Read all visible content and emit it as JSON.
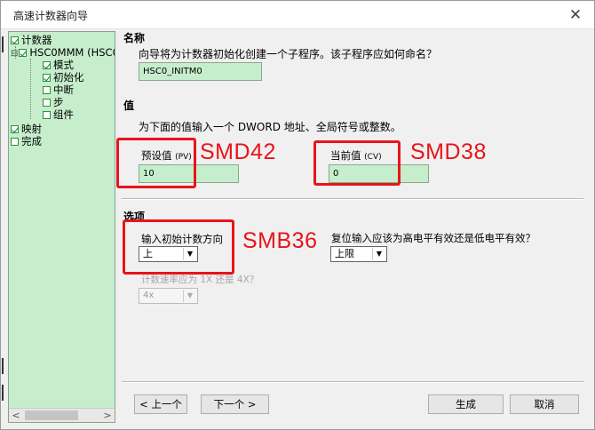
{
  "window": {
    "title": "高速计数器向导",
    "close_icon": "close-icon"
  },
  "tree": {
    "items": [
      {
        "label": "计数器",
        "checked": true
      },
      {
        "label": "HSC0MMM (HSC0",
        "checked": true
      },
      {
        "label": "模式",
        "checked": true
      },
      {
        "label": "初始化",
        "checked": true
      },
      {
        "label": "中断",
        "checked": false
      },
      {
        "label": "步",
        "checked": false
      },
      {
        "label": "组件",
        "checked": false
      },
      {
        "label": "映射",
        "checked": true
      },
      {
        "label": "完成",
        "checked": false
      }
    ],
    "expander": "⊟",
    "scroll_left": "<",
    "scroll_right": ">"
  },
  "name_section": {
    "heading": "名称",
    "prompt": "向导将为计数器初始化创建一个子程序。该子程序应如何命名？",
    "value": "HSC0_INITM0"
  },
  "value_section": {
    "heading": "值",
    "prompt": "为下面的值输入一个 DWORD 地址、全局符号或整数。",
    "pv_label": "预设值",
    "pv_suffix": "(PV)",
    "pv_value": "10",
    "cv_label": "当前值",
    "cv_suffix": "(CV)",
    "cv_value": "0"
  },
  "options_section": {
    "heading": "选项",
    "direction_label": "输入初始计数方向",
    "direction_value": "上",
    "reset_label": "复位输入应该为高电平有效还是低电平有效？",
    "reset_value": "上限",
    "rate_label": "计数速率应为 1X 还是 4X？",
    "rate_value": "4x"
  },
  "annotations": {
    "pv": "SMD42",
    "cv": "SMD38",
    "direction": "SMB36"
  },
  "buttons": {
    "prev": "< 上一个",
    "next": "下一个 >",
    "generate": "生成",
    "cancel": "取消"
  },
  "colors": {
    "panel_green": "#c6eecd",
    "annotation_red": "#e8141b"
  }
}
